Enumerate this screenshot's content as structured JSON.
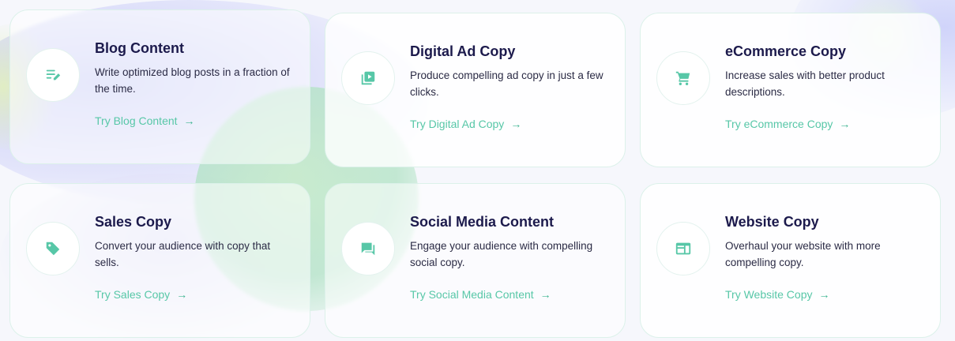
{
  "colors": {
    "accent": "#57c7a7",
    "title": "#1c1a4c",
    "text": "#2b2b45",
    "card_border": "#dcf1ea"
  },
  "cards": [
    {
      "title": "Blog Content",
      "description": "Write optimized blog posts in a fraction of the time.",
      "link": "Try Blog Content",
      "arrow": "→",
      "icon": "blog-edit-icon"
    },
    {
      "title": "Digital Ad Copy",
      "description": "Produce compelling ad copy in just a few clicks.",
      "link": "Try Digital Ad Copy",
      "arrow": "→",
      "icon": "video-library-icon"
    },
    {
      "title": "eCommerce Copy",
      "description": "Increase sales with better product descriptions.",
      "link": "Try eCommerce Copy",
      "arrow": "→",
      "icon": "shopping-cart-icon"
    },
    {
      "title": "Sales Copy",
      "description": "Convert your audience with copy that sells.",
      "link": "Try Sales Copy",
      "arrow": "→",
      "icon": "price-tag-icon"
    },
    {
      "title": "Social Media Content",
      "description": "Engage your audience with compelling social copy.",
      "link": "Try Social Media Content",
      "arrow": "→",
      "icon": "chat-bubble-icon"
    },
    {
      "title": "Website Copy",
      "description": "Overhaul your website with more compelling copy.",
      "link": "Try Website Copy",
      "arrow": "→",
      "icon": "website-layout-icon"
    }
  ]
}
